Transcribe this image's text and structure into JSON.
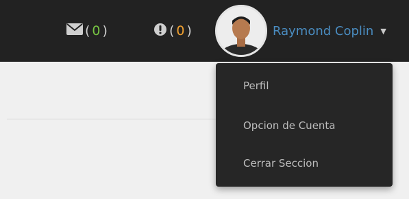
{
  "topbar": {
    "messages": {
      "icon": "envelope-icon",
      "open": "(",
      "count": "0",
      "close": ")"
    },
    "alerts": {
      "icon": "exclamation-circle-icon",
      "open": "(",
      "count": "0",
      "close": ")"
    },
    "user": {
      "name": "Raymond Coplin",
      "caret_icon": "caret-down-icon"
    }
  },
  "dropdown": {
    "items": [
      {
        "label": "Perfil"
      },
      {
        "label": "Opcion de Cuenta"
      },
      {
        "label": "Cerrar Seccion"
      }
    ]
  },
  "colors": {
    "topbar_bg": "#222222",
    "messages_count": "#76c442",
    "alerts_count": "#f0a030",
    "username": "#4a8cc0",
    "dropdown_bg": "#262626"
  }
}
